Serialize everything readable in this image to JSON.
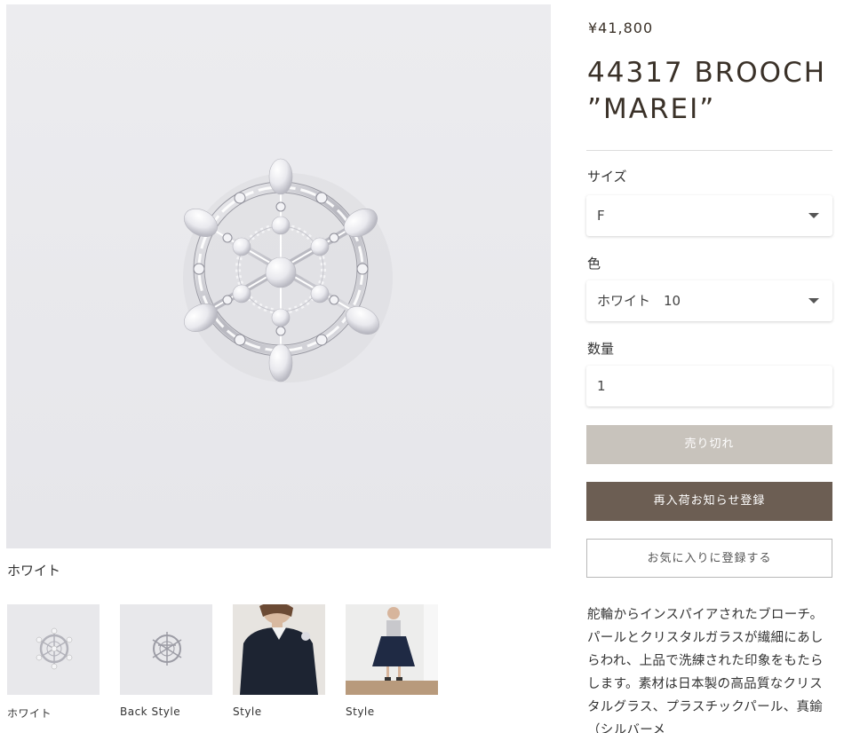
{
  "product": {
    "price": "¥41,800",
    "title": "44317 BROOCH ”MAREI”",
    "variant_caption": "ホワイト",
    "description": "舵輪からインスパイアされたブローチ。パールとクリスタルガラスが繊細にあしらわれ、上品で洗練された印象をもたらします。素材は日本製の高品質なクリスタルグラス、プラスチックパール、真鍮（シルバーメ"
  },
  "options": {
    "size_label": "サイズ",
    "size_value": "F",
    "color_label": "色",
    "color_value": "ホワイト　10",
    "quantity_label": "数量",
    "quantity_value": "1"
  },
  "buttons": {
    "sold_out": "売り切れ",
    "notify": "再入荷お知らせ登録",
    "favorite": "お気に入りに登録する"
  },
  "thumbnails": [
    {
      "label": "ホワイト",
      "icon": "brooch-front"
    },
    {
      "label": "Back Style",
      "icon": "brooch-back"
    },
    {
      "label": "Style",
      "icon": "model-sweater"
    },
    {
      "label": "Style",
      "icon": "model-skirt"
    }
  ],
  "colors": {
    "sold_out_bg": "#c8c3bc",
    "notify_bg": "#6c5e53",
    "text_brown": "#3a3128"
  }
}
